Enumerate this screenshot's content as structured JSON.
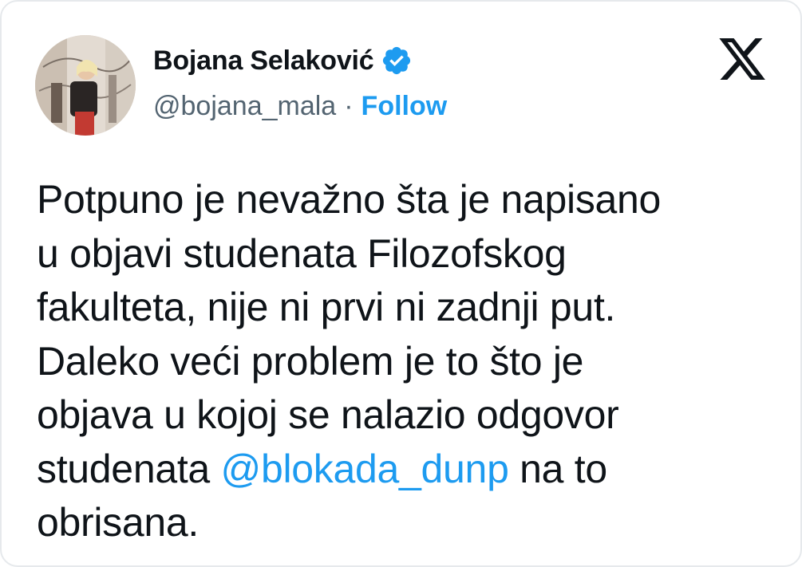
{
  "author": {
    "display_name": "Bojana Selaković",
    "handle": "@bojana_mala",
    "separator": "·",
    "follow_label": "Follow",
    "verified_color": "#1d9bf0"
  },
  "platform": {
    "logo_icon": "x-logo-icon"
  },
  "tweet": {
    "line1": "Potpuno je nevažno šta je napisano",
    "line2": "u objavi studenata Filozofskog",
    "line3": "fakulteta, nije ni prvi ni zadnji put.",
    "line4": "Daleko veći problem je to što je",
    "line5": "objava u kojoj se nalazio odgovor",
    "line6_before": "studenata ",
    "line6_mention": "@blokada_dunp",
    "line6_after": " na to",
    "line7": "obrisana."
  },
  "colors": {
    "text": "#0f1419",
    "secondary": "#536471",
    "accent": "#1d9bf0",
    "border": "#e6e9ec"
  }
}
